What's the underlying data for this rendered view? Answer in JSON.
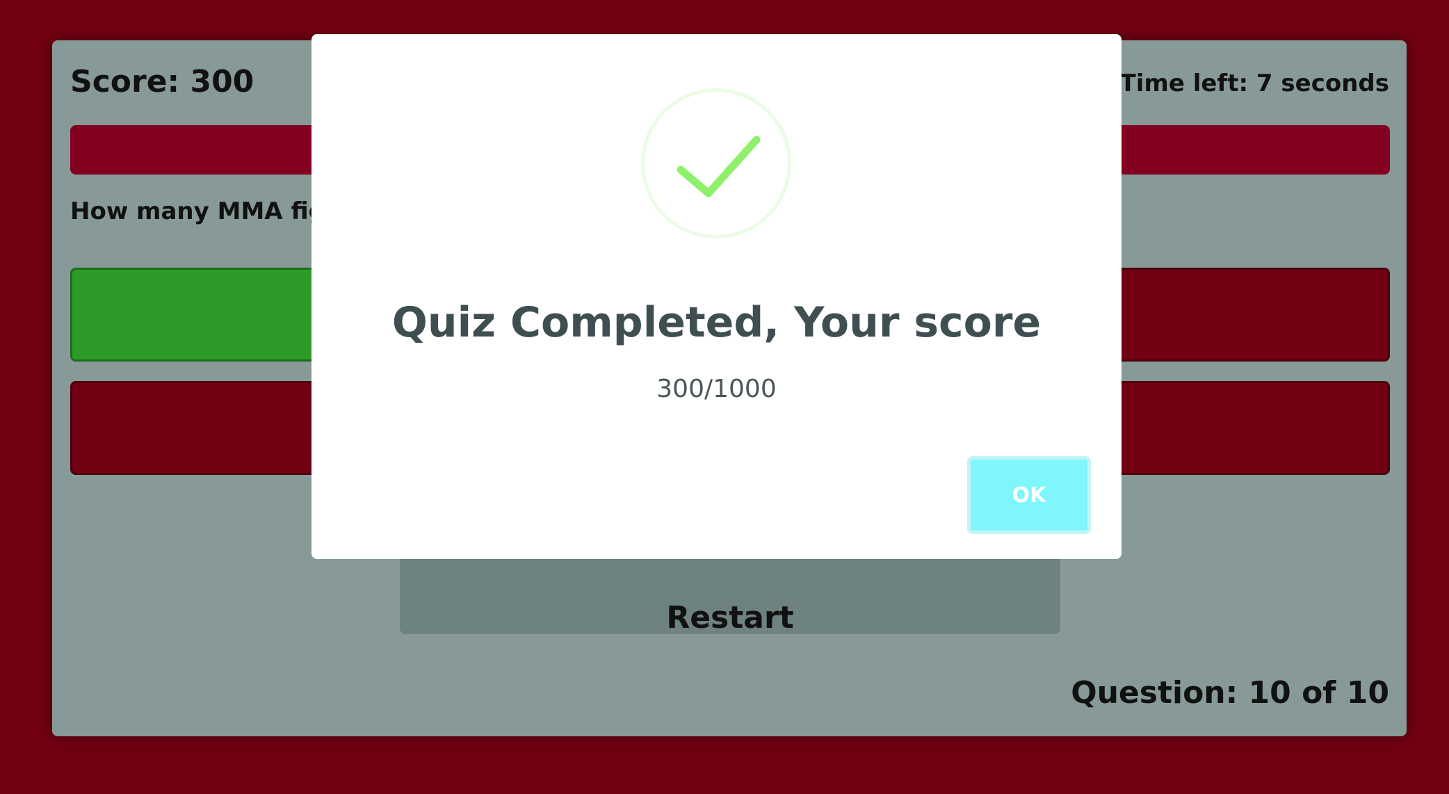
{
  "quiz": {
    "score_text": "Score: 300",
    "timer_text": "Time left: 7 seconds",
    "question_text": "How many MMA fig",
    "restart_label": "Restart",
    "question_counter": "Question: 10 of 10",
    "answers": [
      {
        "state": "correct"
      },
      {
        "state": "default"
      },
      {
        "state": "default"
      },
      {
        "state": "default"
      }
    ]
  },
  "modal": {
    "icon": "success-check-icon",
    "title": "Quiz Completed, Your score",
    "text": "300/1000",
    "ok_label": "OK"
  },
  "colors": {
    "page_background": "#720012",
    "card_background": "#879a98",
    "time_bar": "#830020",
    "correct_answer": "#2d9a28",
    "answer_default": "#720012",
    "ok_button": "#7ef6fb",
    "check_color": "#8ef06b"
  }
}
